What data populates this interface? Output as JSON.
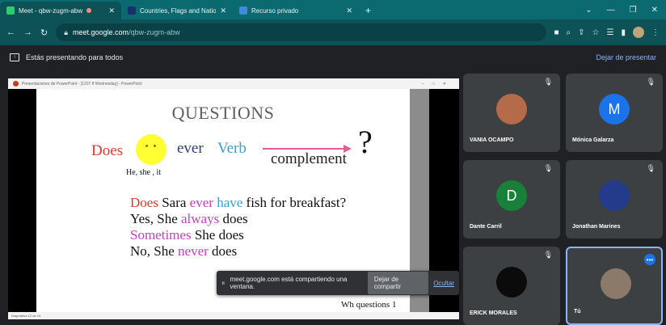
{
  "browser": {
    "tabs": [
      {
        "label": "Meet - qbw-zugm-abw",
        "fav_color": "#2ecc71",
        "active": true
      },
      {
        "label": "Countries, Flags and Nationalitie",
        "fav_color": "#1a2f6b",
        "active": false
      },
      {
        "label": "Recurso privado",
        "fav_color": "#3d8bd9",
        "active": false
      }
    ],
    "new_tab": "+",
    "url_host": "meet.google.com",
    "url_path": "/qbw-zugm-abw"
  },
  "meet": {
    "presenting_text": "Estás presentando para todos",
    "stop_presenting": "Dejar de presentar",
    "share_notice": "meet.google.com está compartiendo una ventana.",
    "stop_sharing": "Dejar de compartir",
    "hide": "Ocultar"
  },
  "powerpoint": {
    "titlebar": "Presentaciones de PowerPoint - [1207 If Wednesday] - PowerPoint",
    "status": "Diapositiva 12 de 13"
  },
  "slide": {
    "title": "QUESTIONS",
    "does": "Does",
    "ever": "ever",
    "verb": "Verb",
    "complement": "complement",
    "question_mark": "?",
    "subjects": "He, she , it",
    "line1": {
      "a": "Does",
      "b": " Sara ",
      "c": "ever",
      "d": " ",
      "e": "have",
      "f": "  fish for breakfast?"
    },
    "line2": {
      "a": "Yes, She ",
      "b": "always",
      "c": " does"
    },
    "line3": {
      "a": "Sometimes",
      "b": " She does"
    },
    "line4": {
      "a": "No, She ",
      "b": "never",
      "c": " does"
    },
    "footer": "Wh questions 1"
  },
  "participants": [
    {
      "name": "VANIA OCAMPO",
      "initial": "",
      "pic_color": "#b56a4a"
    },
    {
      "name": "Mónica Galarza",
      "initial": "M",
      "pic_color": "#1a73e8"
    },
    {
      "name": "Dante Carril",
      "initial": "D",
      "pic_color": "#188038"
    },
    {
      "name": "Jonathan Marines",
      "initial": "",
      "pic_color": "#243a8a"
    },
    {
      "name": "ERICK MORALES",
      "initial": "",
      "pic_color": "#0b0b0b"
    },
    {
      "name": "Tú",
      "initial": "",
      "pic_color": "#8b7a6a"
    }
  ]
}
